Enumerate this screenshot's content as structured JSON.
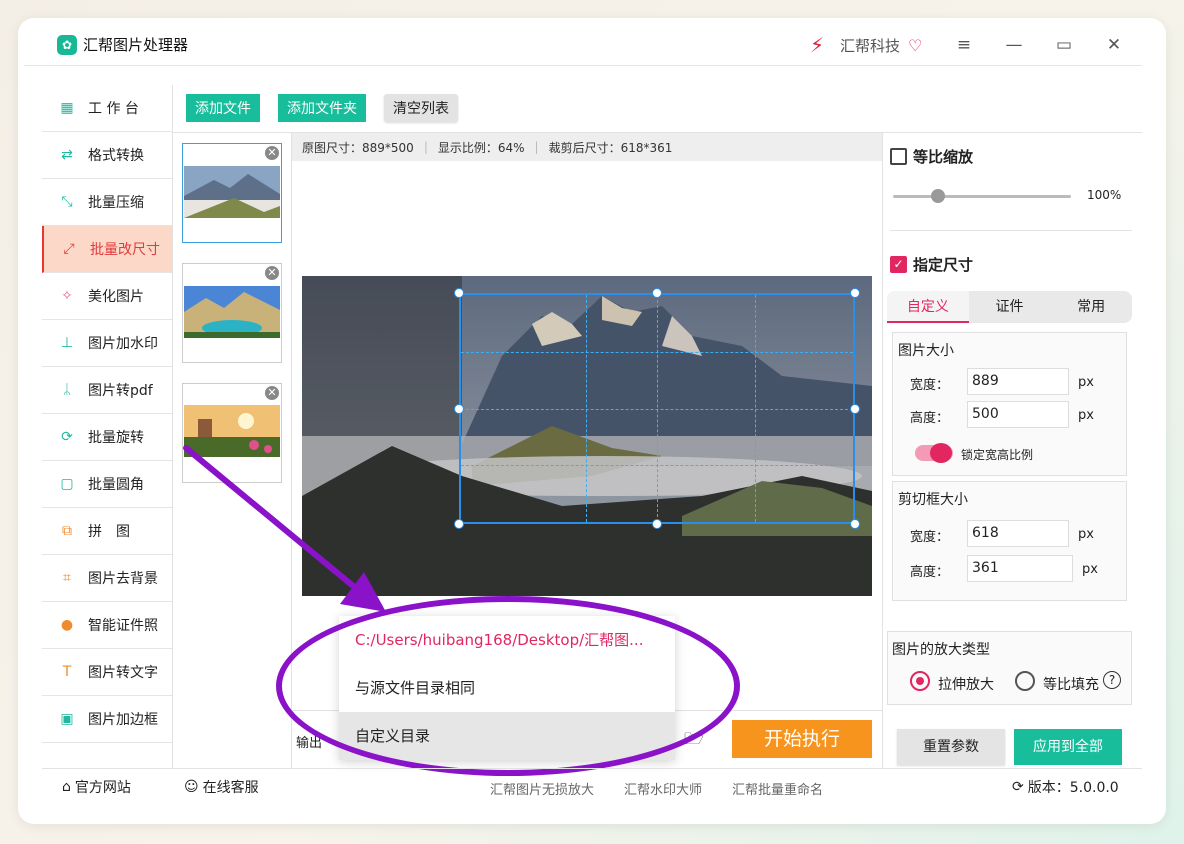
{
  "app": {
    "title": "汇帮图片处理器",
    "brand": "汇帮科技"
  },
  "sidebar": {
    "items": [
      {
        "label": "工 作 台",
        "icon": "grid-icon"
      },
      {
        "label": "格式转换",
        "icon": "convert-icon"
      },
      {
        "label": "批量压缩",
        "icon": "compress-icon"
      },
      {
        "label": "批量改尺寸",
        "icon": "resize-icon",
        "active": true
      },
      {
        "label": "美化图片",
        "icon": "beautify-icon"
      },
      {
        "label": "图片加水印",
        "icon": "stamp-icon"
      },
      {
        "label": "图片转pdf",
        "icon": "pdf-icon"
      },
      {
        "label": "批量旋转",
        "icon": "rotate-icon"
      },
      {
        "label": "批量圆角",
        "icon": "round-corner-icon"
      },
      {
        "label": "拼　图",
        "icon": "collage-icon"
      },
      {
        "label": "图片去背景",
        "icon": "crop-icon"
      },
      {
        "label": "智能证件照",
        "icon": "person-icon"
      },
      {
        "label": "图片转文字",
        "icon": "text-icon"
      },
      {
        "label": "图片加边框",
        "icon": "frame-icon"
      }
    ]
  },
  "toolbar": {
    "add_file": "添加文件",
    "add_folder": "添加文件夹",
    "clear_list": "清空列表"
  },
  "info": {
    "original": "原图尺寸：889*500",
    "scale": "显示比例：64%",
    "cropped": "裁剪后尺寸：618*361"
  },
  "right": {
    "proportional_label": "等比缩放",
    "proportional_value": "100%",
    "proportional_fraction": 0.2,
    "specify_label": "指定尺寸",
    "tabs": [
      "自定义",
      "证件",
      "常用"
    ],
    "image_size_title": "图片大小",
    "width_label": "宽度：",
    "height_label": "高度：",
    "width_value": "889",
    "height_value": "500",
    "unit": "px",
    "lock_label": "锁定宽高比例",
    "crop_title": "剪切框大小",
    "crop_width": "618",
    "crop_height": "361",
    "enlarge_title": "图片的放大类型",
    "stretch_label": "拉伸放大",
    "fill_label": "等比填充",
    "help": "?",
    "reset": "重置参数",
    "apply_all": "应用到全部"
  },
  "output": {
    "label": "输出",
    "start": "开始执行"
  },
  "dropdown": {
    "items": [
      "C:/Users/huibang168/Desktop/汇帮图...",
      "与源文件目录相同",
      "自定义目录"
    ]
  },
  "footer": {
    "website": "官方网站",
    "service": "在线客服",
    "links": [
      "汇帮图片无损放大",
      "汇帮水印大师",
      "汇帮批量重命名"
    ],
    "version": "版本：5.0.0.0"
  }
}
